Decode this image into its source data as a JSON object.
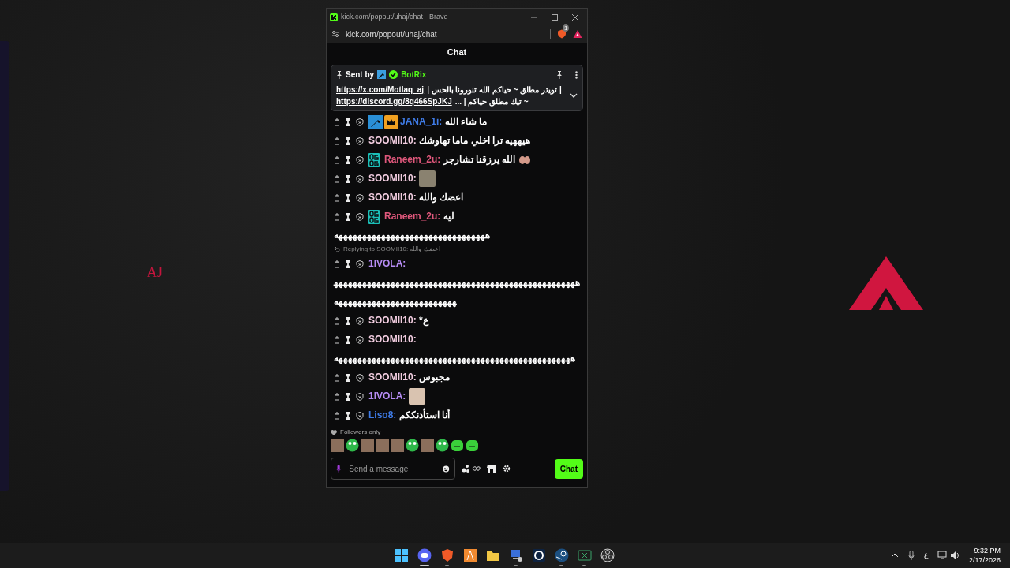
{
  "desktop": {
    "wallpaper_title": "AJ"
  },
  "browser": {
    "title": "kick.com/popout/uhaj/chat - Brave",
    "url": "kick.com/popout/uhaj/chat",
    "shield_count": "1"
  },
  "chat": {
    "header": "Chat",
    "pinned": {
      "sent_by": "Sent by",
      "bot_name": "BotRix",
      "lines": [
        [
          {
            "kind": "text",
            "text": "| تويتر مطلق ~ حياكم الله تنورونا بالحس |"
          },
          {
            "kind": "link",
            "text": "https://x.com/Motlaq_aj"
          }
        ],
        [
          {
            "kind": "text",
            "text": "~ تيك مطلق حياكم | ..."
          },
          {
            "kind": "link",
            "text": "https://discord.gg/8q466SpJKJ"
          }
        ]
      ]
    },
    "messages": [
      {
        "user": "JANA_1i:",
        "color": "#3f7be6",
        "badges": [
          {
            "kind": "pickaxe"
          },
          {
            "kind": "crown"
          }
        ],
        "kind": "text",
        "text": "ما شاء الله"
      },
      {
        "user": "SOOMII10:",
        "color": "#f2cde0",
        "kind": "text",
        "text": "هيههيه ترا اخلي ماما تهاوشك"
      },
      {
        "user": "Raneem_2u:",
        "color": "#e0587c",
        "badges": [
          {
            "kind": "og"
          }
        ],
        "kind": "text",
        "text": "الله يرزقنا تشارجر",
        "emoji": [
          {
            "kind": "hands"
          }
        ]
      },
      {
        "user": "SOOMII10:",
        "color": "#f2cde0",
        "kind": "emote"
      },
      {
        "user": "SOOMII10:",
        "color": "#f2cde0",
        "kind": "text",
        "text": "اعضك والله"
      },
      {
        "user": "Raneem_2u:",
        "color": "#e0587c",
        "badges": [
          {
            "kind": "og"
          }
        ],
        "kind": "text",
        "text": "ليه",
        "wrapped": "ههههههههههههههههههههههههههههههههه"
      },
      {
        "user": "1IVOLA:",
        "color": "#b68cf4",
        "kind": "text",
        "reply": "Replying to SOOMII10: اعضك والله",
        "wrapped": "هههههههههههههههههههههههههههههههههههههههههههههههههههههههههههههههههههههههههههههه"
      },
      {
        "user": "SOOMII10:",
        "color": "#f2cde0",
        "kind": "text",
        "text": "ع*"
      },
      {
        "user": "SOOMII10:",
        "color": "#f2cde0",
        "kind": "text",
        "wrapped": "ههههههههههههههههههههههههههههههههههههههههههههههههههه"
      },
      {
        "user": "SOOMII10:",
        "color": "#f2cde0",
        "kind": "text",
        "text": "مجبوس"
      },
      {
        "user": "1IVOLA:",
        "color": "#b68cf4",
        "kind": "emote"
      },
      {
        "user": "Liso8:",
        "color": "#3f7be6",
        "kind": "text",
        "text": "أنا استأذنككم"
      }
    ],
    "mode": "Followers only",
    "emotes": [
      {
        "kind": "photo"
      },
      {
        "kind": "frog"
      },
      {
        "kind": "photo"
      },
      {
        "kind": "photo"
      },
      {
        "kind": "photo"
      },
      {
        "kind": "frog"
      },
      {
        "kind": "photo"
      },
      {
        "kind": "frog"
      },
      {
        "kind": "blob"
      },
      {
        "kind": "blob"
      }
    ],
    "input": {
      "placeholder": "Send a message"
    },
    "send_button": "Chat"
  },
  "taskbar": {
    "apps": [
      {
        "kind": "start",
        "running": false,
        "selected": false
      },
      {
        "kind": "discord",
        "running": true,
        "selected": true
      },
      {
        "kind": "brave",
        "running": true,
        "selected": false
      },
      {
        "kind": "orange",
        "running": false,
        "selected": false
      },
      {
        "kind": "folder",
        "running": false,
        "selected": false
      },
      {
        "kind": "computer",
        "running": true,
        "selected": false
      },
      {
        "kind": "camera",
        "running": false,
        "selected": false
      },
      {
        "kind": "steam",
        "running": true,
        "selected": false
      },
      {
        "kind": "terminal",
        "running": true,
        "selected": false
      },
      {
        "kind": "obs",
        "running": false,
        "selected": false
      }
    ],
    "keyboard": "ع",
    "time": "9:32 PM",
    "date": "2/17/2026"
  }
}
